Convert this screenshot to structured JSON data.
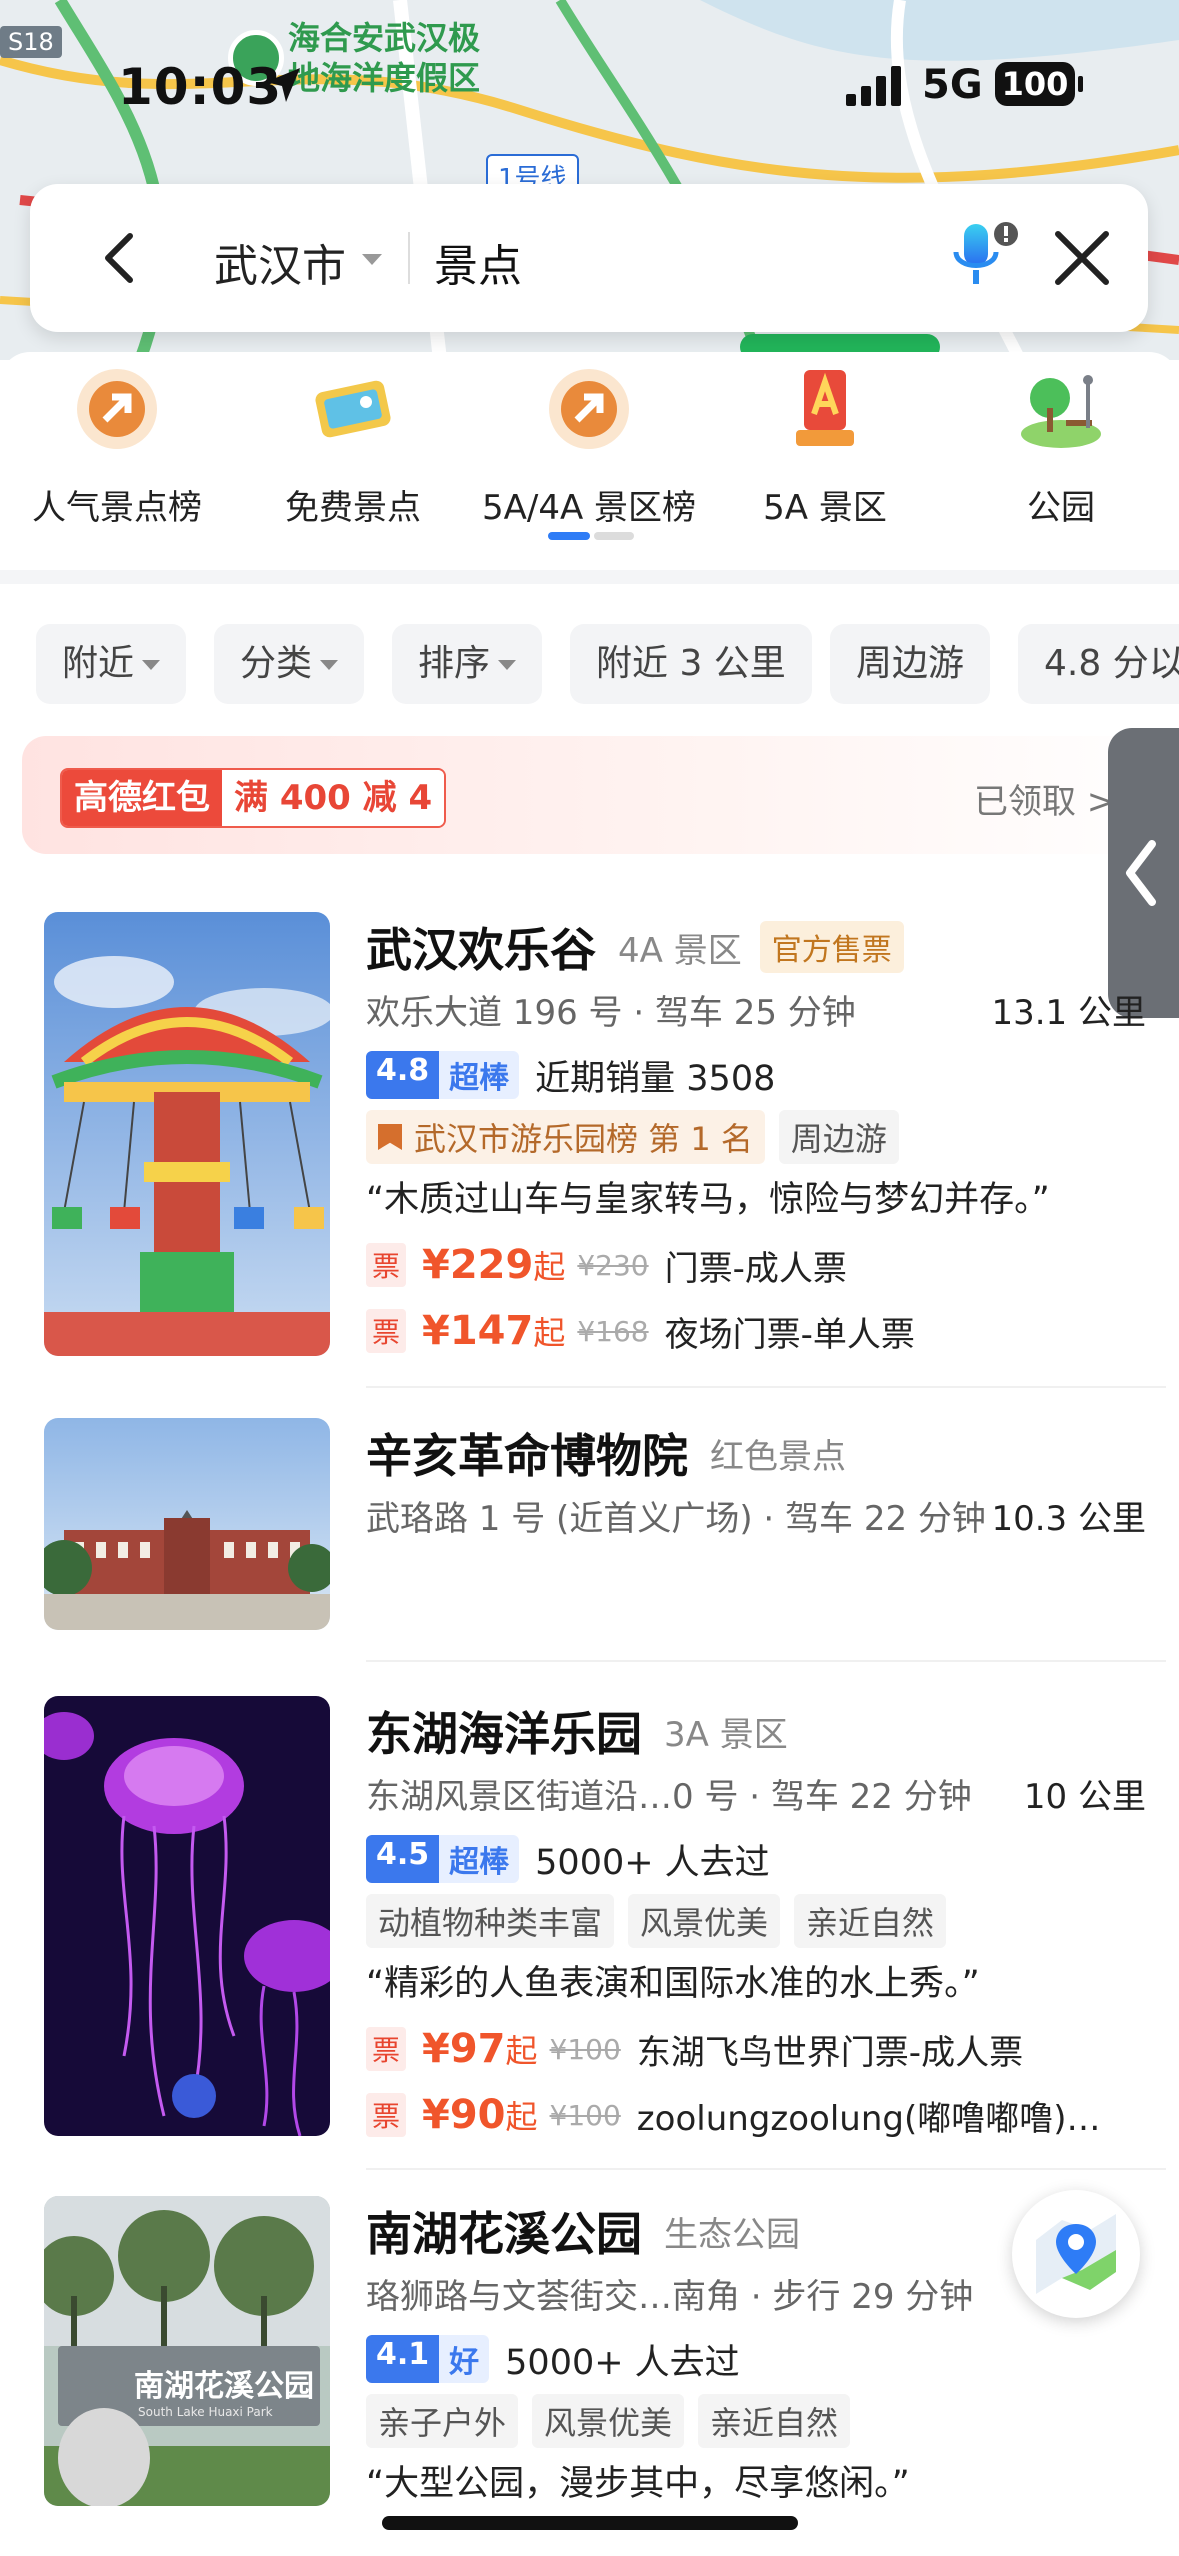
{
  "status_bar": {
    "time": "10:03",
    "network": "5G",
    "battery": "100"
  },
  "map": {
    "poi_label": "海合安武汉极\n地海洋度假区",
    "road_badge": "S18",
    "metro_line": "1号线"
  },
  "search": {
    "city": "武汉市",
    "query": "景点"
  },
  "categories": [
    {
      "label": "人气景点榜",
      "icon": "trending-badge-icon"
    },
    {
      "label": "免费景点",
      "icon": "ticket-icon"
    },
    {
      "label": "5A/4A 景区榜",
      "icon": "trending-badge-icon"
    },
    {
      "label": "5A 景区",
      "icon": "5a-badge-icon"
    },
    {
      "label": "公园",
      "icon": "park-icon"
    }
  ],
  "filters": [
    {
      "label": "附近",
      "dropdown": true
    },
    {
      "label": "分类",
      "dropdown": true
    },
    {
      "label": "排序",
      "dropdown": true
    },
    {
      "label": "附近 3 公里",
      "dropdown": false
    },
    {
      "label": "周边游",
      "dropdown": false
    },
    {
      "label": "4.8 分以",
      "dropdown": false
    }
  ],
  "promo": {
    "brand": "高德红包",
    "offer": "满 400 减 4",
    "status": "已领取 >"
  },
  "results": [
    {
      "name": "武汉欢乐谷",
      "level": "4A 景区",
      "official_tag": "官方售票",
      "address": "欢乐大道 196 号 · 驾车 25 分钟",
      "distance": "13.1 公里",
      "rating": "4.8",
      "rating_word": "超棒",
      "stat": "近期销量 3508",
      "rank_tag": "武汉市游乐园榜 第 1 名",
      "tags": [
        "周边游"
      ],
      "quote": "“木质过山车与皇家转马，惊险与梦幻并存。”",
      "tickets": [
        {
          "badge": "票",
          "price": "¥229",
          "suffix": "起",
          "original": "¥230",
          "name": "门票-成人票"
        },
        {
          "badge": "票",
          "price": "¥147",
          "suffix": "起",
          "original": "¥168",
          "name": "夜场门票-单人票"
        }
      ]
    },
    {
      "name": "辛亥革命博物院",
      "level": "红色景点",
      "address": "武珞路 1 号 (近首义广场) · 驾车 22 分钟",
      "distance": "10.3 公里"
    },
    {
      "name": "东湖海洋乐园",
      "level": "3A 景区",
      "address": "东湖风景区街道沿…0 号 · 驾车 22 分钟",
      "distance": "10 公里",
      "rating": "4.5",
      "rating_word": "超棒",
      "stat": "5000+ 人去过",
      "tags": [
        "动植物种类丰富",
        "风景优美",
        "亲近自然"
      ],
      "quote": "“精彩的人鱼表演和国际水准的水上秀。”",
      "tickets": [
        {
          "badge": "票",
          "price": "¥97",
          "suffix": "起",
          "original": "¥100",
          "name": "东湖飞鸟世界门票-成人票"
        },
        {
          "badge": "票",
          "price": "¥90",
          "suffix": "起",
          "original": "¥100",
          "name": "zoolungzoolung(嘟噜嘟噜)…"
        }
      ]
    },
    {
      "name": "南湖花溪公园",
      "level": "生态公园",
      "address": "珞狮路与文荟街交…南角 · 步行 29 分钟",
      "rating": "4.1",
      "rating_word": "好",
      "stat": "5000+ 人去过",
      "tags": [
        "亲子户外",
        "风景优美",
        "亲近自然"
      ],
      "quote": "“大型公园，漫步其中，尽享悠闲。”",
      "sign_text": "南湖花溪公园",
      "sign_subtext": "South Lake Huaxi Park"
    }
  ],
  "colors": {
    "accent": "#3b78ed",
    "price": "#f0552b",
    "promo": "#ec4a3b"
  }
}
